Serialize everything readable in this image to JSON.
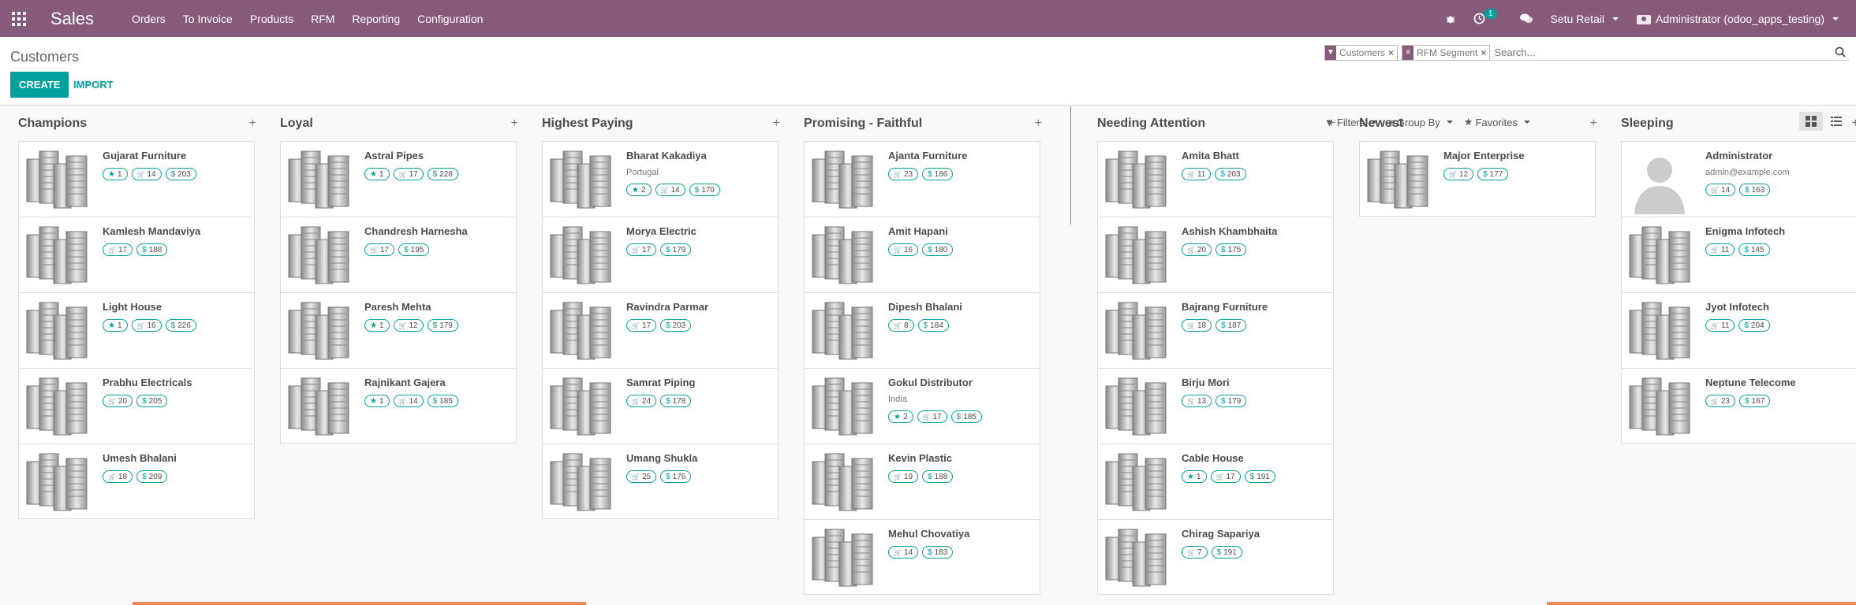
{
  "app": {
    "title": "Sales",
    "menu": [
      "Orders",
      "To Invoice",
      "Products",
      "RFM",
      "Reporting",
      "Configuration"
    ]
  },
  "systray": {
    "activity_count": "1",
    "company": "Setu Retail",
    "user": "Administrator (odoo_apps_testing)"
  },
  "breadcrumb": "Customers",
  "buttons": {
    "create": "CREATE",
    "import": "IMPORT"
  },
  "search": {
    "facets": [
      "Customers",
      "RFM Segment"
    ],
    "placeholder": "Search..."
  },
  "filters": {
    "filters": "Filters",
    "group_by": "Group By",
    "favorites": "Favorites"
  },
  "colors": {
    "brand": "#875a7b",
    "accent": "#00a09d"
  },
  "columns": [
    {
      "title": "Champions",
      "cards": [
        {
          "name": "Gujarat Furniture",
          "tags": [
            [
              "star",
              "1"
            ],
            [
              "cart",
              "14"
            ],
            [
              "$",
              "203"
            ]
          ]
        },
        {
          "name": "Kamlesh Mandaviya",
          "tags": [
            [
              "cart",
              "17"
            ],
            [
              "$",
              "188"
            ]
          ]
        },
        {
          "name": "Light House",
          "tags": [
            [
              "star",
              "1"
            ],
            [
              "cart",
              "16"
            ],
            [
              "$",
              "226"
            ]
          ]
        },
        {
          "name": "Prabhu Electricals",
          "tags": [
            [
              "cart",
              "20"
            ],
            [
              "$",
              "205"
            ]
          ]
        },
        {
          "name": "Umesh Bhalani",
          "tags": [
            [
              "cart",
              "18"
            ],
            [
              "$",
              "209"
            ]
          ]
        }
      ]
    },
    {
      "title": "Loyal",
      "cards": [
        {
          "name": "Astral Pipes",
          "tags": [
            [
              "star",
              "1"
            ],
            [
              "cart",
              "17"
            ],
            [
              "$",
              "228"
            ]
          ]
        },
        {
          "name": "Chandresh Harnesha",
          "tags": [
            [
              "cart",
              "17"
            ],
            [
              "$",
              "195"
            ]
          ]
        },
        {
          "name": "Paresh Mehta",
          "tags": [
            [
              "star",
              "1"
            ],
            [
              "cart",
              "12"
            ],
            [
              "$",
              "179"
            ]
          ]
        },
        {
          "name": "Rajnikant Gajera",
          "tags": [
            [
              "star",
              "1"
            ],
            [
              "cart",
              "14"
            ],
            [
              "$",
              "185"
            ]
          ]
        }
      ]
    },
    {
      "title": "Highest Paying",
      "cards": [
        {
          "name": "Bharat Kakadiya",
          "sub": "Portugal",
          "tags": [
            [
              "star",
              "2"
            ],
            [
              "cart",
              "14"
            ],
            [
              "$",
              "170"
            ]
          ]
        },
        {
          "name": "Morya Electric",
          "tags": [
            [
              "cart",
              "17"
            ],
            [
              "$",
              "179"
            ]
          ]
        },
        {
          "name": "Ravindra Parmar",
          "tags": [
            [
              "cart",
              "17"
            ],
            [
              "$",
              "203"
            ]
          ]
        },
        {
          "name": "Samrat Piping",
          "tags": [
            [
              "cart",
              "24"
            ],
            [
              "$",
              "178"
            ]
          ]
        },
        {
          "name": "Umang Shukla",
          "tags": [
            [
              "cart",
              "25"
            ],
            [
              "$",
              "176"
            ]
          ]
        }
      ]
    },
    {
      "title": "Promising - Faithful",
      "cards": [
        {
          "name": "Ajanta Furniture",
          "tags": [
            [
              "cart",
              "23"
            ],
            [
              "$",
              "186"
            ]
          ]
        },
        {
          "name": "Amit Hapani",
          "tags": [
            [
              "cart",
              "16"
            ],
            [
              "$",
              "180"
            ]
          ]
        },
        {
          "name": "Dipesh Bhalani",
          "tags": [
            [
              "cart",
              "8"
            ],
            [
              "$",
              "184"
            ]
          ]
        },
        {
          "name": "Gokul Distributor",
          "sub": "India",
          "tags": [
            [
              "star",
              "2"
            ],
            [
              "cart",
              "17"
            ],
            [
              "$",
              "185"
            ]
          ]
        },
        {
          "name": "Kevin Plastic",
          "tags": [
            [
              "cart",
              "19"
            ],
            [
              "$",
              "188"
            ]
          ]
        },
        {
          "name": "Mehul Chovatiya",
          "tags": [
            [
              "cart",
              "14"
            ],
            [
              "$",
              "183"
            ]
          ]
        }
      ]
    },
    {
      "title": "Needing Attention",
      "cards": [
        {
          "name": "Amita Bhatt",
          "tags": [
            [
              "cart",
              "11"
            ],
            [
              "$",
              "203"
            ]
          ]
        },
        {
          "name": "Ashish Khambhaita",
          "tags": [
            [
              "cart",
              "20"
            ],
            [
              "$",
              "175"
            ]
          ]
        },
        {
          "name": "Bajrang Furniture",
          "tags": [
            [
              "cart",
              "18"
            ],
            [
              "$",
              "187"
            ]
          ]
        },
        {
          "name": "Birju Mori",
          "tags": [
            [
              "cart",
              "13"
            ],
            [
              "$",
              "179"
            ]
          ]
        },
        {
          "name": "Cable House",
          "tags": [
            [
              "star",
              "1"
            ],
            [
              "cart",
              "17"
            ],
            [
              "$",
              "191"
            ]
          ]
        },
        {
          "name": "Chirag Sapariya",
          "tags": [
            [
              "cart",
              "7"
            ],
            [
              "$",
              "191"
            ]
          ]
        }
      ]
    },
    {
      "title": "Newest",
      "cards": [
        {
          "name": "Major Enterprise",
          "tags": [
            [
              "cart",
              "12"
            ],
            [
              "$",
              "177"
            ]
          ]
        }
      ]
    },
    {
      "title": "Sleeping",
      "cards": [
        {
          "name": "Administrator",
          "sub": "admin@example.com",
          "avatar": "person",
          "tags": [
            [
              "cart",
              "14"
            ],
            [
              "$",
              "163"
            ]
          ]
        },
        {
          "name": "Enigma Infotech",
          "tags": [
            [
              "cart",
              "11"
            ],
            [
              "$",
              "145"
            ]
          ]
        },
        {
          "name": "Jyot Infotech",
          "tags": [
            [
              "cart",
              "11"
            ],
            [
              "$",
              "204"
            ]
          ]
        },
        {
          "name": "Neptune Telecome",
          "tags": [
            [
              "cart",
              "23"
            ],
            [
              "$",
              "167"
            ]
          ]
        }
      ]
    }
  ]
}
